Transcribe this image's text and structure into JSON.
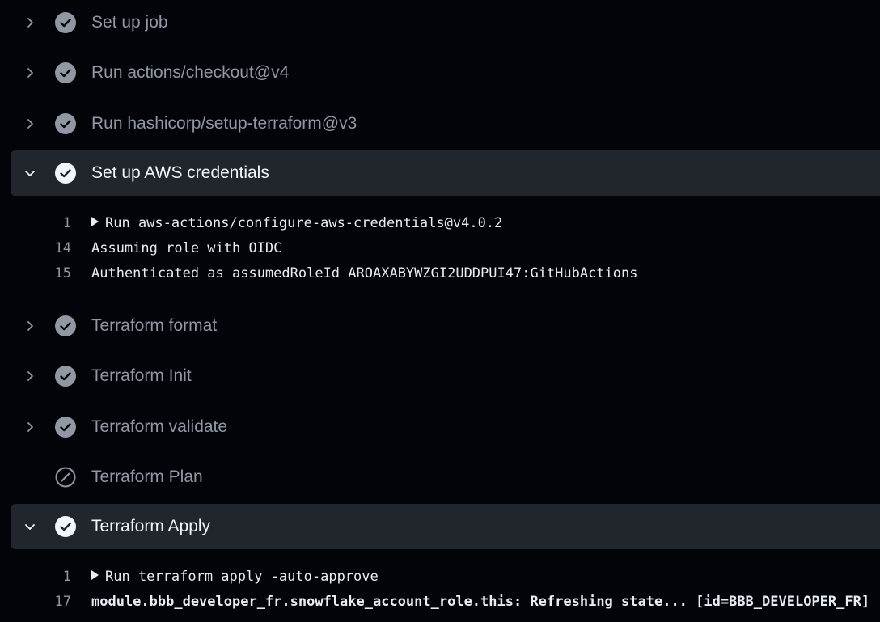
{
  "steps": [
    {
      "name": "Set up job",
      "status": "success",
      "expanded": false
    },
    {
      "name": "Run actions/checkout@v4",
      "status": "success",
      "expanded": false
    },
    {
      "name": "Run hashicorp/setup-terraform@v3",
      "status": "success",
      "expanded": false
    },
    {
      "name": "Set up AWS credentials",
      "status": "success",
      "expanded": true
    },
    {
      "name": "Terraform format",
      "status": "success",
      "expanded": false
    },
    {
      "name": "Terraform Init",
      "status": "success",
      "expanded": false
    },
    {
      "name": "Terraform validate",
      "status": "success",
      "expanded": false
    },
    {
      "name": "Terraform Plan",
      "status": "skipped",
      "expanded": false
    },
    {
      "name": "Terraform Apply",
      "status": "success",
      "expanded": true
    }
  ],
  "logs": {
    "aws_credentials": [
      {
        "num": "1",
        "text": "Run aws-actions/configure-aws-credentials@v4.0.2",
        "group": true
      },
      {
        "num": "14",
        "text": "Assuming role with OIDC"
      },
      {
        "num": "15",
        "text": "Authenticated as assumedRoleId AROAXABYWZGI2UDDPUI47:GitHubActions"
      }
    ],
    "terraform_apply": [
      {
        "num": "1",
        "text": "Run terraform apply -auto-approve",
        "group": true
      },
      {
        "num": "17",
        "text": "module.bbb_developer_fr.snowflake_account_role.this: Refreshing state... [id=BBB_DEVELOPER_FR]",
        "bold": true
      }
    ]
  },
  "colors": {
    "background": "#010409",
    "expanded_row": "#21262d",
    "muted_text": "#9198a1",
    "success_icon": "#9198a1",
    "expanded_icon": "#f0f6fc"
  }
}
